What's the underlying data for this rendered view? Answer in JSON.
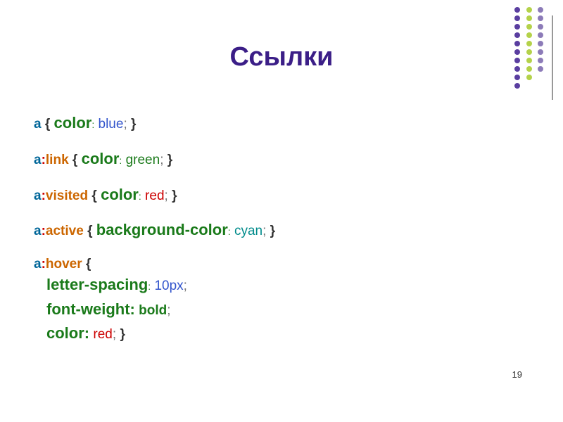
{
  "title": "Ссылки",
  "page_number": "19",
  "rules": {
    "r1": {
      "selector": "a",
      "property": "color",
      "value": "blue"
    },
    "r2": {
      "selector": "a",
      "pseudo": "link",
      "property": "color",
      "value": "green"
    },
    "r3": {
      "selector": "a",
      "pseudo": "visited",
      "property": "color",
      "value": "red"
    },
    "r4": {
      "selector": "a",
      "pseudo": "active",
      "property": "background-color",
      "value": "cyan"
    },
    "r5": {
      "selector": "a",
      "pseudo": "hover",
      "d1_prop": "letter-spacing",
      "d1_val": "10px",
      "d2_prop": "font-weight:",
      "d2_val": "bold",
      "d3_prop": "color:",
      "d3_val": "red"
    }
  },
  "punct": {
    "open": "{",
    "close": "}",
    "semi": ";",
    "colon": ":"
  },
  "deco_colors": {
    "col_a": [
      "#5a3ea0",
      "#5a3ea0",
      "#5a3ea0",
      "#5a3ea0",
      "#5a3ea0",
      "#5a3ea0",
      "#5a3ea0",
      "#5a3ea0",
      "#5a3ea0",
      "#5a3ea0"
    ],
    "col_b": [
      "#b4d24a",
      "#b4d24a",
      "#b4d24a",
      "#b4d24a",
      "#b4d24a",
      "#b4d24a",
      "#b4d24a",
      "#b4d24a",
      "#b4d24a"
    ],
    "col_c": [
      "#8c7bb8",
      "#8c7bb8",
      "#8c7bb8",
      "#8c7bb8",
      "#8c7bb8",
      "#8c7bb8",
      "#8c7bb8",
      "#8c7bb8"
    ]
  }
}
